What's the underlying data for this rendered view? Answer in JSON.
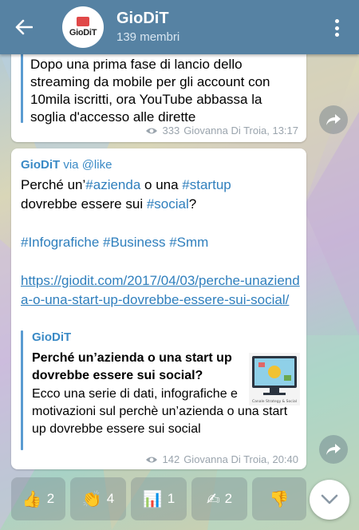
{
  "header": {
    "title": "GioDiT",
    "subtitle": "139 membri",
    "avatar_text": "GioDiT"
  },
  "message1": {
    "text": "Dopo una prima fase di lancio dello streaming da mobile per gli account con 10mila iscritti, ora YouTube abbassa la soglia d'accesso alle dirette",
    "views": "333",
    "author_time": "Giovanna Di Troia, 13:17"
  },
  "message2": {
    "via_name": "GioDiT",
    "via_word": "via",
    "via_bot": "@like",
    "line1_a": "Perché un’",
    "line1_tag1": "#azienda",
    "line1_b": " o una ",
    "line1_tag2": "#startup",
    "line2_a": "dovrebbe essere sui ",
    "line2_tag": "#social",
    "line2_b": "?",
    "tag_infografiche": "#Infografiche",
    "tag_business": "#Business",
    "tag_smm": "#Smm",
    "link": "https://giodit.com/2017/04/03/perche-unazienda-o-una-start-up-dovrebbe-essere-sui-social/",
    "preview": {
      "site": "GioDiT",
      "title": "Perché un’azienda o una start up dovrebbe essere sui social?",
      "description": "Ecco una serie di dati, infografiche e motivazioni sul perchè un’azienda o una start up dovrebbe essere sui social",
      "thumb_caption": "Canale Strategy & Social"
    },
    "views": "142",
    "author_time": "Giovanna Di Troia, 20:40"
  },
  "reactions": [
    {
      "emoji": "👍",
      "count": "2",
      "icon": "thumbs-up-icon"
    },
    {
      "emoji": "👏",
      "count": "4",
      "icon": "clapping-hands-icon"
    },
    {
      "emoji": "📊",
      "count": "1",
      "icon": "bar-chart-icon"
    },
    {
      "emoji": "✍",
      "count": "2",
      "icon": "writing-hand-icon"
    },
    {
      "emoji": "👎",
      "count": "",
      "icon": "thumbs-down-icon"
    }
  ],
  "colors": {
    "header": "#5682a3",
    "link": "#2f7fbd",
    "meta": "#9aa4ad"
  }
}
